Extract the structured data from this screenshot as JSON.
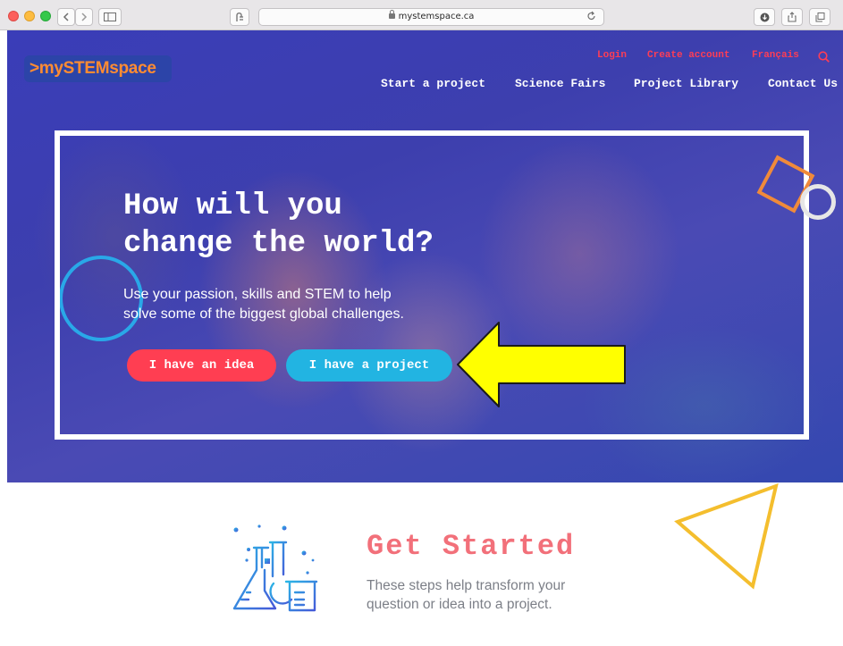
{
  "browser": {
    "url": "mystemspace.ca",
    "back_icon": "chevron-left-icon",
    "forward_icon": "chevron-right-icon",
    "reload_icon": "reload-icon"
  },
  "header": {
    "logo_text": ">mySTEMspace",
    "utility_links": [
      "Login",
      "Create account",
      "Français"
    ],
    "nav": [
      "Start a project",
      "Science Fairs",
      "Project Library",
      "Contact Us"
    ]
  },
  "hero": {
    "headline_line1": "How will you",
    "headline_line2": "change the world?",
    "subtitle_line1": "Use your passion, skills and STEM to help",
    "subtitle_line2": "solve some of the biggest global challenges.",
    "primary_button": "I have an idea",
    "secondary_button": "I have a project"
  },
  "get_started": {
    "title": "Get Started",
    "text_line1": "These steps help transform your",
    "text_line2": "question or idea into a project."
  },
  "colors": {
    "accent_red": "#ff3e52",
    "accent_blue": "#22b4e2",
    "logo_orange": "#ff8c32",
    "title_pink": "#f2707a",
    "annotation_yellow": "#ffff00"
  }
}
